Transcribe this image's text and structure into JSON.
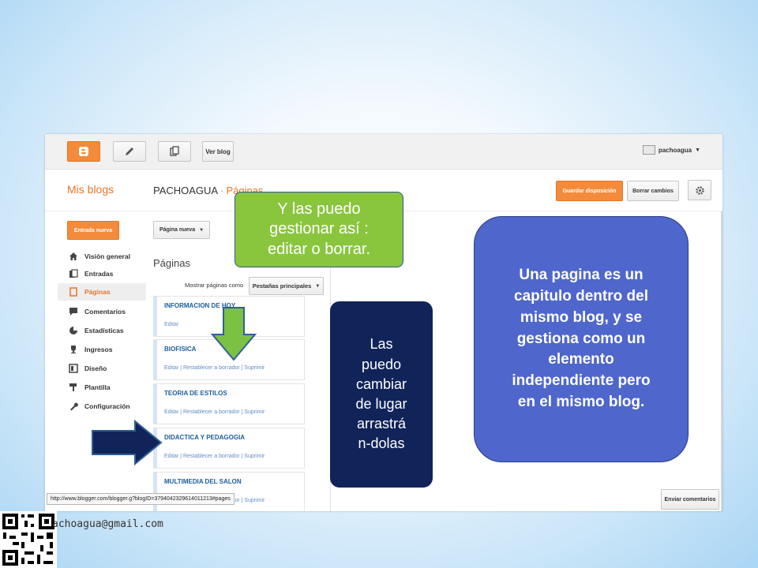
{
  "topbar": {
    "view_blog_label": "Ver blog",
    "username": "pachoagua",
    "brand_color": "#f38b3a"
  },
  "header": {
    "my_blogs": "Mis blogs",
    "blog_name": "PACHOAGUA",
    "separator": "·",
    "section": "Páginas",
    "save_layout_label": "Guardar disposición",
    "discard_changes_label": "Borrar cambios"
  },
  "sidebar": {
    "new_post_label": "Entrada nueva",
    "items": [
      {
        "label": "Visión general",
        "icon": "home-icon"
      },
      {
        "label": "Entradas",
        "icon": "posts-icon"
      },
      {
        "label": "Páginas",
        "icon": "pages-icon",
        "active": true
      },
      {
        "label": "Comentarios",
        "icon": "comment-icon"
      },
      {
        "label": "Estadísticas",
        "icon": "pie-chart-icon"
      },
      {
        "label": "Ingresos",
        "icon": "trophy-icon"
      },
      {
        "label": "Diseño",
        "icon": "layout-icon"
      },
      {
        "label": "Plantilla",
        "icon": "paint-roller-icon"
      },
      {
        "label": "Configuración",
        "icon": "wrench-icon"
      }
    ]
  },
  "main": {
    "new_page_label": "Página nueva",
    "heading": "Páginas",
    "show_as_label": "Mostrar páginas como",
    "show_as_value": "Pestañas principales",
    "pages": [
      {
        "title": "INFORMACION DE HOY",
        "actions": "Editar"
      },
      {
        "title": "BIOFISICA",
        "actions": "Editar | Restablecer a borrador | Suprimir"
      },
      {
        "title": "TEORIA DE ESTILOS",
        "actions": "Editar | Restablecer a borrador | Suprimir"
      },
      {
        "title": "DIDACTICA Y PEDAGOGIA",
        "actions": "Editar | Restablecer a borrador | Suprimir"
      },
      {
        "title": "MULTIMEDIA DEL SALON",
        "actions": "Editar | Restablecer a borrador | Suprimir"
      }
    ]
  },
  "status_url": "http://www.blogger.com/blogger.g?blogID=3794042329614011213#pages",
  "send_comments_label": "Enviar comentarios",
  "callouts": {
    "green": "Y las puedo\ngestionar así :\neditar o  borrar.",
    "navy": "Las\npuedo\ncambiar\nde lugar\narrastrá\nn-dolas",
    "blue": "Una pagina es un\ncapitulo dentro del\nmismo blog, y se\ngestiona  como un\nelemento\nindependiente pero\nen el mismo blog."
  },
  "footer": {
    "email": "achoagua@gmail.com"
  },
  "colors": {
    "callout_green": "#8ac53e",
    "callout_navy": "#10245a",
    "callout_blue": "#4f66cc",
    "link_blue": "#1b5e9e"
  }
}
